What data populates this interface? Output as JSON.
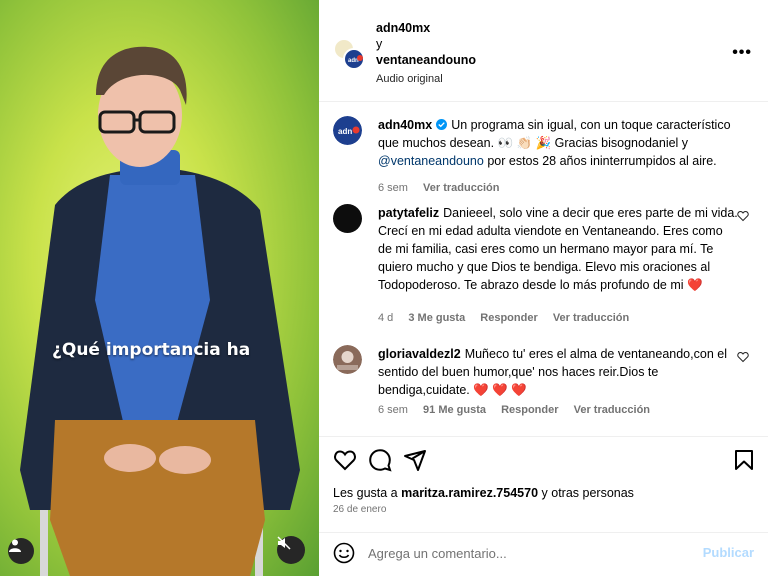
{
  "video": {
    "caption": "¿Qué importancia ha",
    "user_tag_icon": "person-icon",
    "mute_icon": "speaker-muted-icon"
  },
  "header": {
    "user1": "adn40mx",
    "joiner": "y",
    "user2": "ventaneandouno",
    "audio": "Audio original",
    "more_icon": "more-dots-icon",
    "more_label": "•••"
  },
  "post": {
    "user": "adn40mx",
    "text": "Un programa sin igual, con un toque característico que muchos desean. 👀 👏🏻 🎉 Gracias bisognodaniel y",
    "mention": "@ventaneandouno",
    "text2": "por estos 28 años ininterrumpidos al aire.",
    "time": "6 sem",
    "translate": "Ver traducción"
  },
  "comments": [
    {
      "user": "patytafeliz",
      "text": "Danieeel, solo vine a decir que eres parte de mi vida. Crecí en mi edad adulta viendote en Ventaneando. Eres como de mi familia, casi eres como un hermano mayor para mí. Te quiero mucho y que Dios te bendiga. Elevo mis oraciones al Todopoderoso. Te abrazo desde lo más profundo de mi",
      "emoji": "❤️",
      "time": "4 d",
      "likes": "3 Me gusta",
      "reply": "Responder",
      "translate": "Ver traducción"
    },
    {
      "user": "gloriavaldezl2",
      "text": "Muñeco tu' eres el alma de ventaneando,con el sentido del buen humor,que' nos haces reir.Dios te bendiga,cuidate.",
      "emoji": "❤️ ❤️ ❤️",
      "time": "6 sem",
      "likes": "91 Me gusta",
      "reply": "Responder",
      "translate": "Ver traducción"
    }
  ],
  "actions": {
    "like_icon": "heart-icon",
    "comment_icon": "comment-bubble-icon",
    "share_icon": "paper-plane-icon",
    "save_icon": "bookmark-icon",
    "likes_prefix": "Les gusta a",
    "likes_user": "maritza.ramirez.754570",
    "likes_suffix": "y otras personas",
    "date": "26 de enero"
  },
  "add_comment": {
    "emoji_icon": "smiley-icon",
    "placeholder": "Agrega un comentario...",
    "post_label": "Publicar"
  },
  "colors": {
    "like_red": "#ed4956",
    "verified_blue": "#0095f6",
    "publish_disabled": "#b3dbff"
  }
}
